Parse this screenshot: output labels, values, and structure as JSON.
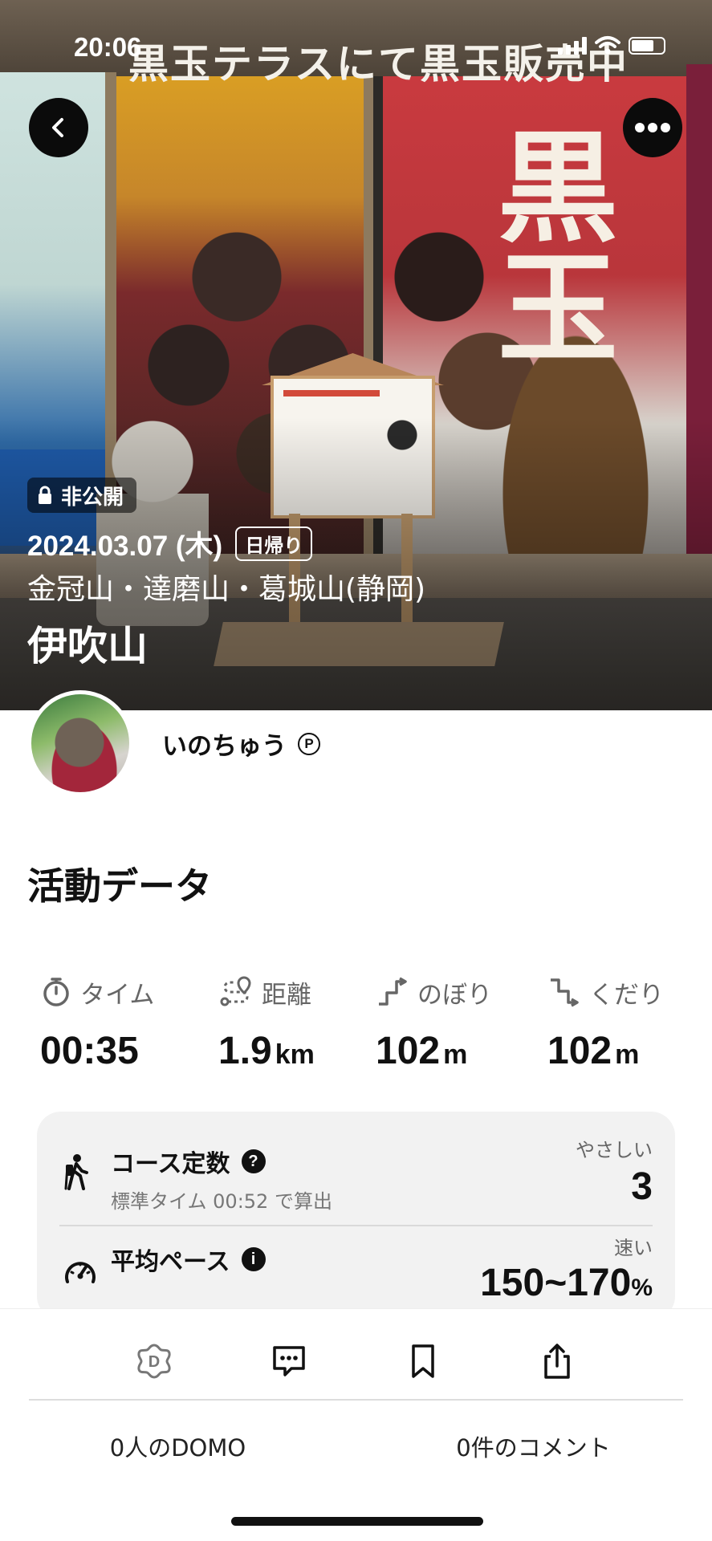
{
  "status_bar": {
    "time": "20:06"
  },
  "hero": {
    "banner_text": "黒玉テラスにて黒玉販売中",
    "store_mark": "黒玉",
    "private_badge": "非公開",
    "date": "2024.03.07 (木)",
    "trip_type": "日帰り",
    "mountains": "金冠山・達磨山・葛城山(静岡)",
    "title": "伊吹山",
    "icons": {
      "back": "chevron-left-icon",
      "more": "ellipsis-icon",
      "lock": "lock-icon"
    }
  },
  "user": {
    "name": "いのちゅう",
    "premium_mark": "P"
  },
  "activity": {
    "section_title": "活動データ",
    "stats": [
      {
        "label": "タイム",
        "icon": "stopwatch-icon",
        "value": "00:35",
        "unit": ""
      },
      {
        "label": "距離",
        "icon": "route-icon",
        "value": "1.9",
        "unit": "km"
      },
      {
        "label": "のぼり",
        "icon": "ascent-icon",
        "value": "102",
        "unit": "m"
      },
      {
        "label": "くだり",
        "icon": "descent-icon",
        "value": "102",
        "unit": "m"
      }
    ],
    "course": {
      "title": "コース定数",
      "help_icon": "question-icon",
      "subtitle": "標準タイム 00:52 で算出",
      "rating_label": "やさしい",
      "value": "3"
    },
    "pace": {
      "title": "平均ペース",
      "info_icon": "info-icon",
      "rating_label": "速い",
      "value": "150~170",
      "unit": "%"
    }
  },
  "bottom_bar": {
    "actions": [
      "domo-icon",
      "comment-icon",
      "bookmark-icon",
      "share-icon"
    ],
    "domo_count": "0人のDOMO",
    "comment_count": "0件のコメント"
  }
}
